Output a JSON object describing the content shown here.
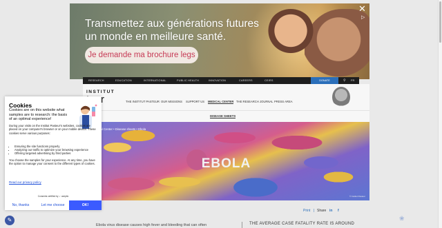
{
  "ad": {
    "headline": "Transmettez aux générations futures un monde en meilleure santé.",
    "cta": "Je demande ma brochure legs"
  },
  "topnav": {
    "items": [
      "RESEARCH",
      "EDUCATION",
      "INTERNATIONAL",
      "PUBLIC HEALTH",
      "INNOVATION",
      "CAREERS",
      "CEIRS"
    ],
    "donate": "DONATE",
    "lang": "FR"
  },
  "logo": {
    "line1": "INSTITUT",
    "line2": "teur"
  },
  "mainnav": {
    "items": [
      "THE INSTITUT PASTEUR",
      "OUR MISSIONS",
      "SUPPORT US",
      "MEDICAL CENTER",
      "THE RESEARCH JOURNAL",
      "PRESS AREA"
    ]
  },
  "subnav": {
    "tab": "DISEASE SHEETS"
  },
  "hero": {
    "title": "EBOLA",
    "breadcrumb": "dical Center  •  Disease sheets  •  Ebola",
    "credit": "© Institut Pasteur"
  },
  "share": {
    "print": "Print",
    "share": "Share"
  },
  "article": {
    "intro": "Ebola virus disease causes high fever and bleeding that can often",
    "stat": "THE AVERAGE CASE FATALITY RATE IS AROUND"
  },
  "cookie": {
    "title": "Cookies",
    "lead": "Cookies are on this website what samples are to research: the basis of an optimal experience!",
    "p1": "During your visits on the Institut Pasteur's websites, cookies are placed on your computer's browser or on your mobile device. These cookies serve various purposes:",
    "list": [
      "Ensuring the site functions properly",
      "Analyzing our traffic to optimize your browsing experience",
      "Offering targeted advertising by third parties"
    ],
    "p2": "You choose the samples for your experience. At any time, you have the option to manage your consent to the different types of cookies.",
    "link": "Read our privacy policy",
    "consents": "Consents certified by ✓ axeptio",
    "no": "No, thanks",
    "choose": "Let me choose",
    "ok": "OK!"
  }
}
